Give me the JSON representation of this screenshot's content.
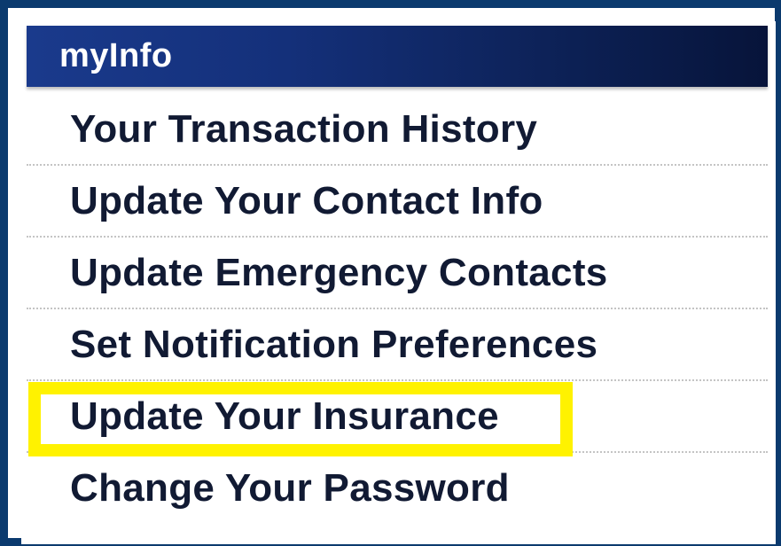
{
  "header": {
    "title": "myInfo"
  },
  "menu": {
    "items": [
      {
        "label": "Your Transaction History"
      },
      {
        "label": "Update Your Contact Info"
      },
      {
        "label": "Update Emergency Contacts"
      },
      {
        "label": "Set Notification Preferences"
      },
      {
        "label": "Update Your Insurance",
        "highlighted": true
      },
      {
        "label": "Change Your Password"
      }
    ]
  },
  "colors": {
    "border": "#0b3a6e",
    "header_gradient_start": "#1a3a8c",
    "header_gradient_end": "#07143a",
    "highlight": "#fff200",
    "text": "#111a33"
  }
}
